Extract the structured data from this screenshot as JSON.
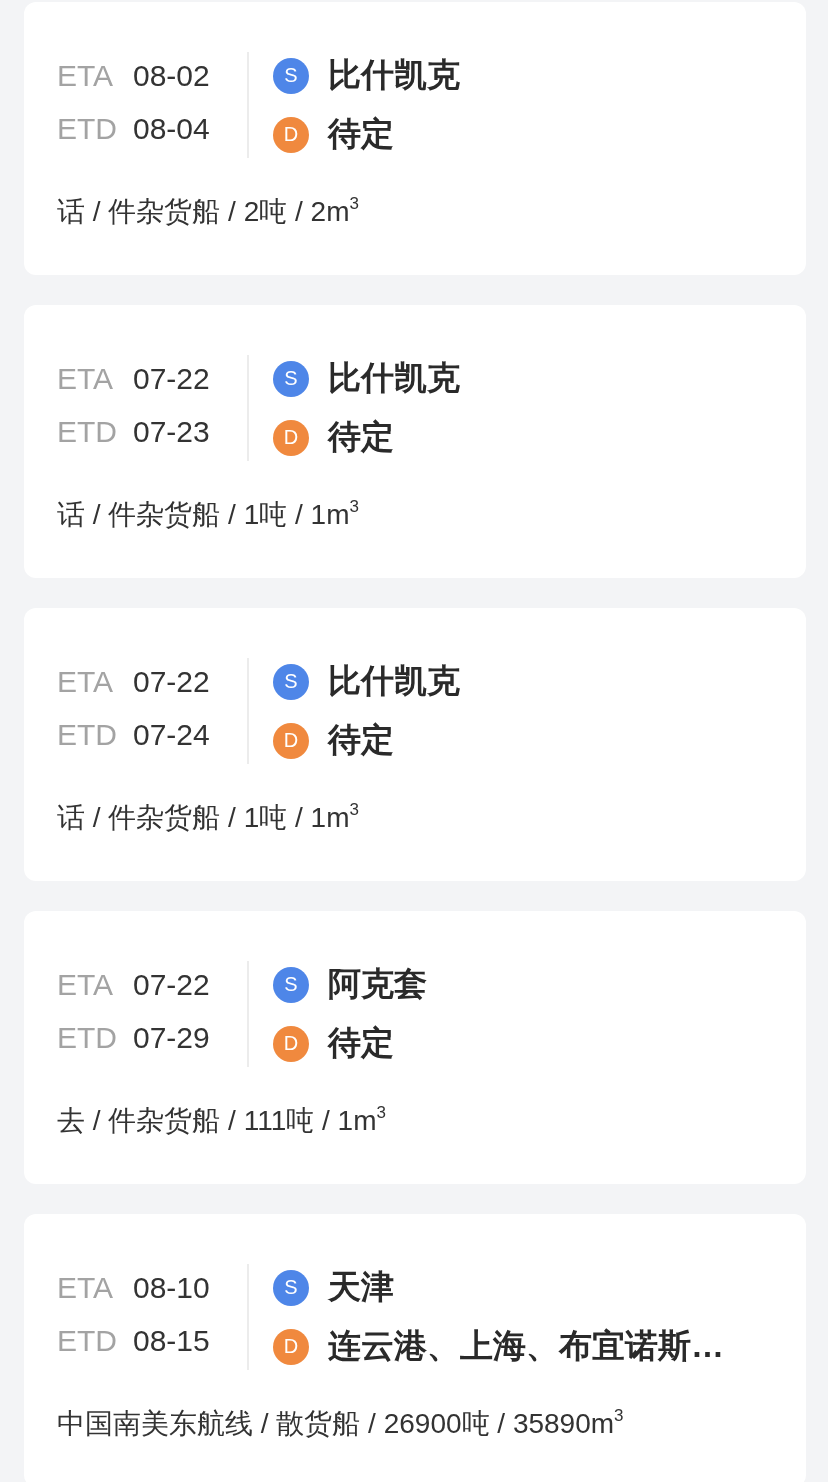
{
  "cards": [
    {
      "times": [
        {
          "label": "ETA",
          "date": "08-02"
        },
        {
          "label": "ETD",
          "date": "08-04"
        }
      ],
      "ports": [
        {
          "badge": "S",
          "color": "#4e86e8",
          "name": "比什凯克"
        },
        {
          "badge": "D",
          "color": "#f0893e",
          "name": "待定"
        }
      ],
      "detail": "话 / 件杂货船 / 2吨 / 2m$^{3}$"
    },
    {
      "times": [
        {
          "label": "ETA",
          "date": "07-22"
        },
        {
          "label": "ETD",
          "date": "07-23"
        }
      ],
      "ports": [
        {
          "badge": "S",
          "color": "#4e86e8",
          "name": "比什凯克"
        },
        {
          "badge": "D",
          "color": "#f0893e",
          "name": "待定"
        }
      ],
      "detail": "话 / 件杂货船 / 1吨 / 1m$^{3}$"
    },
    {
      "times": [
        {
          "label": "ETA",
          "date": "07-22"
        },
        {
          "label": "ETD",
          "date": "07-24"
        }
      ],
      "ports": [
        {
          "badge": "S",
          "color": "#4e86e8",
          "name": "比什凯克"
        },
        {
          "badge": "D",
          "color": "#f0893e",
          "name": "待定"
        }
      ],
      "detail": "话 / 件杂货船 / 1吨 / 1m$^{3}$"
    },
    {
      "times": [
        {
          "label": "ETA",
          "date": "07-22"
        },
        {
          "label": "ETD",
          "date": "07-29"
        }
      ],
      "ports": [
        {
          "badge": "S",
          "color": "#4e86e8",
          "name": "阿克套"
        },
        {
          "badge": "D",
          "color": "#f0893e",
          "name": "待定"
        }
      ],
      "detail": "去 / 件杂货船 / 111吨 / 1m$^{3}$"
    },
    {
      "times": [
        {
          "label": "ETA",
          "date": "08-10"
        },
        {
          "label": "ETD",
          "date": "08-15"
        }
      ],
      "ports": [
        {
          "badge": "S",
          "color": "#4e86e8",
          "name": "天津"
        },
        {
          "badge": "D",
          "color": "#f0893e",
          "name": "连云港、上海、布宜诺斯…"
        }
      ],
      "detail": "中国南美东航线 / 散货船 / 26900吨 / 35890m$^{3}$"
    }
  ]
}
